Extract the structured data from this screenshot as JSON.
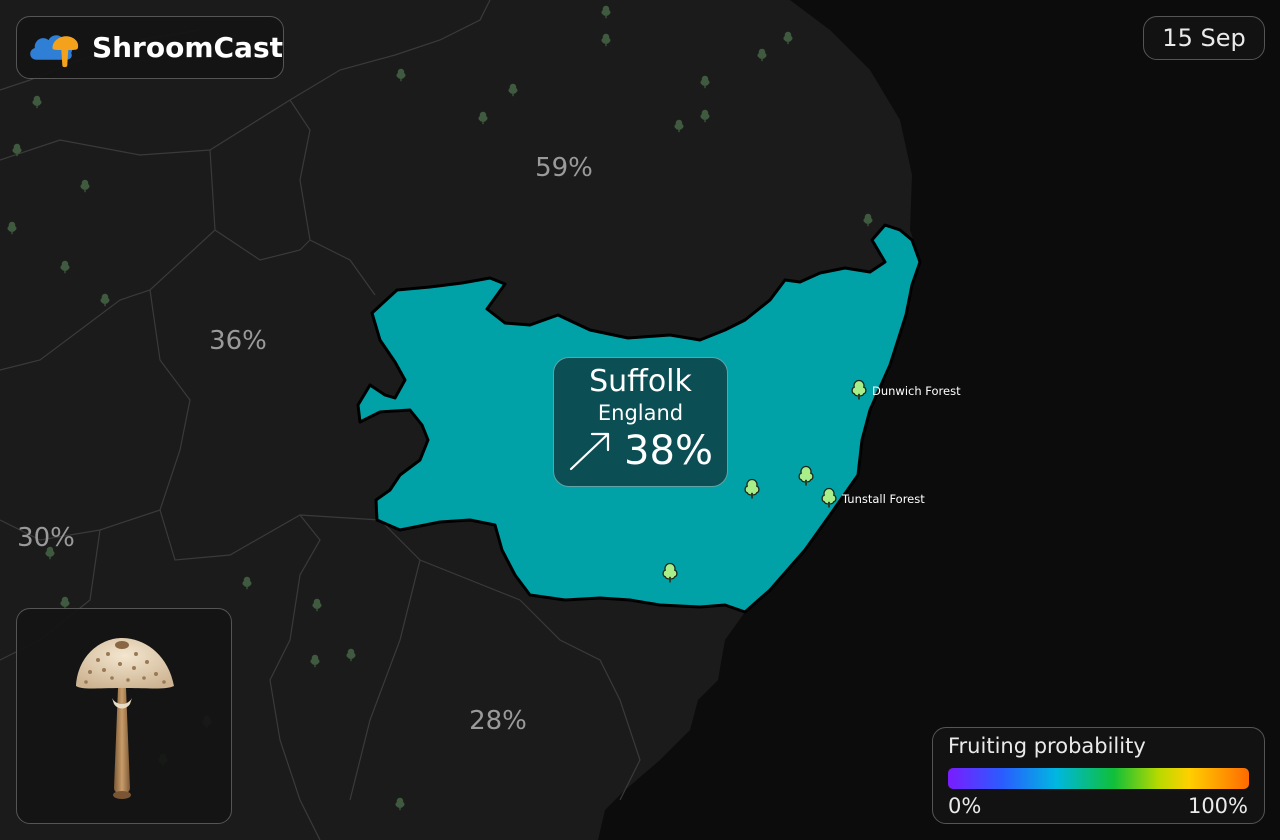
{
  "app": {
    "name": "ShroomCast"
  },
  "date": "15 Sep",
  "selected_region": {
    "county": "Suffolk",
    "country": "England",
    "trend": "rising",
    "probability": "38%"
  },
  "region_labels": [
    {
      "id": "north",
      "value": "59%"
    },
    {
      "id": "west",
      "value": "36%"
    },
    {
      "id": "far-west",
      "value": "30%"
    },
    {
      "id": "south",
      "value": "28%"
    }
  ],
  "forests": [
    {
      "id": "dunwich",
      "name": "Dunwich Forest"
    },
    {
      "id": "tunstall",
      "name": "Tunstall Forest"
    }
  ],
  "legend": {
    "title": "Fruiting probability",
    "min_label": "0%",
    "max_label": "100%"
  },
  "colors": {
    "selected_fill": "#00a2a8",
    "info_box_bg": "#0b4e54",
    "land": "#1b1b1b",
    "sea": "#0c0c0c",
    "tree_dim": "#3f5a3e",
    "tree_bright": "#a8ef8a"
  },
  "species_card": {
    "icon": "parasol-mushroom"
  }
}
